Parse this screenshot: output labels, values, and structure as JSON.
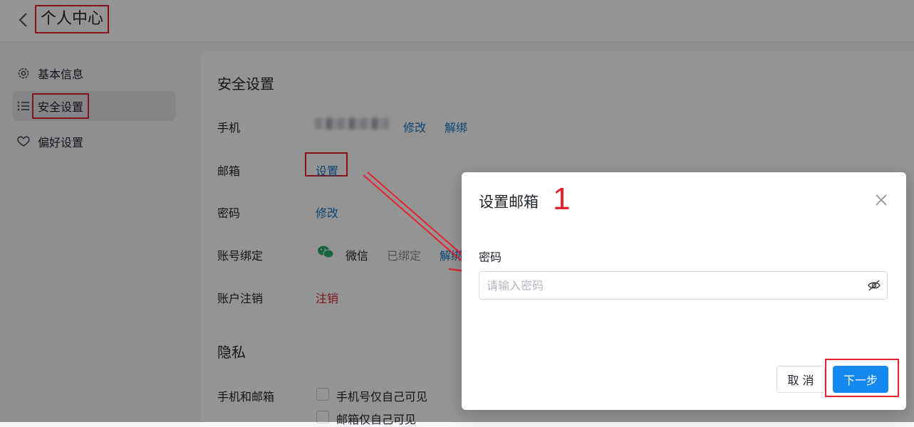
{
  "header": {
    "title": "个人中心"
  },
  "sidebar": {
    "items": [
      {
        "label": "基本信息",
        "icon": "gear-icon"
      },
      {
        "label": "安全设置",
        "icon": "list-icon",
        "active": true
      },
      {
        "label": "偏好设置",
        "icon": "heart-icon"
      }
    ]
  },
  "security": {
    "title": "安全设置",
    "phone": {
      "label": "手机",
      "edit": "修改",
      "unbind": "解绑"
    },
    "email": {
      "label": "邮箱",
      "set": "设置"
    },
    "password": {
      "label": "密码",
      "edit": "修改"
    },
    "account_binding": {
      "label": "账号绑定",
      "service": "微信",
      "status": "已绑定",
      "unbind": "解绑"
    },
    "cancel_account": {
      "label": "账户注销",
      "action": "注销"
    }
  },
  "privacy": {
    "title": "隐私",
    "label": "手机和邮箱",
    "options": [
      {
        "label": "手机号仅自己可见",
        "checked": false
      },
      {
        "label": "邮箱仅自己可见",
        "checked": false
      }
    ]
  },
  "dialog": {
    "title": "设置邮箱",
    "step": "1",
    "password_label": "密码",
    "password_placeholder": "请输入密码",
    "cancel": "取 消",
    "next": "下一步"
  },
  "colors": {
    "accent": "#1389ef",
    "link": "#1677c8",
    "danger": "#d6262c",
    "annotation": "#e5222c"
  }
}
